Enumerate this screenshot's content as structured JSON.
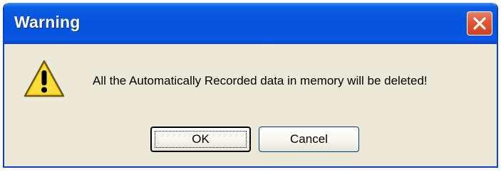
{
  "window": {
    "title": "Warning",
    "close_icon": "close-icon"
  },
  "dialog": {
    "icon": "warning-icon",
    "message": "All the Automatically Recorded data in memory will be deleted!"
  },
  "buttons": {
    "ok_label": "OK",
    "cancel_label": "Cancel"
  },
  "colors": {
    "titlebar": "#0553de",
    "body": "#ece9d8",
    "close_button": "#e15a35",
    "warning_yellow": "#f7d117"
  }
}
